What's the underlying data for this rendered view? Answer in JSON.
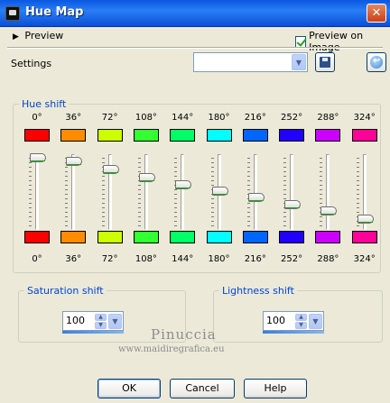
{
  "window": {
    "title": "Hue Map"
  },
  "preview": {
    "toggle_label": "Preview",
    "checkbox_label": "Preview on Image",
    "checked": true
  },
  "settings": {
    "label": "Settings",
    "selected_value": ""
  },
  "hue_shift": {
    "legend": "Hue shift",
    "channels": [
      {
        "label": "0°",
        "top_color": "#ff0000",
        "bottom_color": "#ff0000",
        "level": 0.0
      },
      {
        "label": "36°",
        "top_color": "#ff8c00",
        "bottom_color": "#ff8c00",
        "level": 0.06
      },
      {
        "label": "72°",
        "top_color": "#ccff00",
        "bottom_color": "#ccff00",
        "level": 0.18
      },
      {
        "label": "108°",
        "top_color": "#33ff33",
        "bottom_color": "#33ff33",
        "level": 0.3
      },
      {
        "label": "144°",
        "top_color": "#00ff66",
        "bottom_color": "#00ff66",
        "level": 0.4
      },
      {
        "label": "180°",
        "top_color": "#00ffff",
        "bottom_color": "#00ffff",
        "level": 0.5
      },
      {
        "label": "216°",
        "top_color": "#0066ff",
        "bottom_color": "#0066ff",
        "level": 0.6
      },
      {
        "label": "252°",
        "top_color": "#2200ff",
        "bottom_color": "#2200ff",
        "level": 0.7
      },
      {
        "label": "288°",
        "top_color": "#cc00ff",
        "bottom_color": "#cc00ff",
        "level": 0.8
      },
      {
        "label": "324°",
        "top_color": "#ff0099",
        "bottom_color": "#ff0099",
        "level": 0.92
      }
    ]
  },
  "saturation": {
    "legend": "Saturation shift",
    "value": "100"
  },
  "lightness": {
    "legend": "Lightness shift",
    "value": "100"
  },
  "watermark": {
    "name": "Pinuccia",
    "url": "www.maidiregrafica.eu"
  },
  "buttons": {
    "ok": "OK",
    "cancel": "Cancel",
    "help": "Help"
  }
}
